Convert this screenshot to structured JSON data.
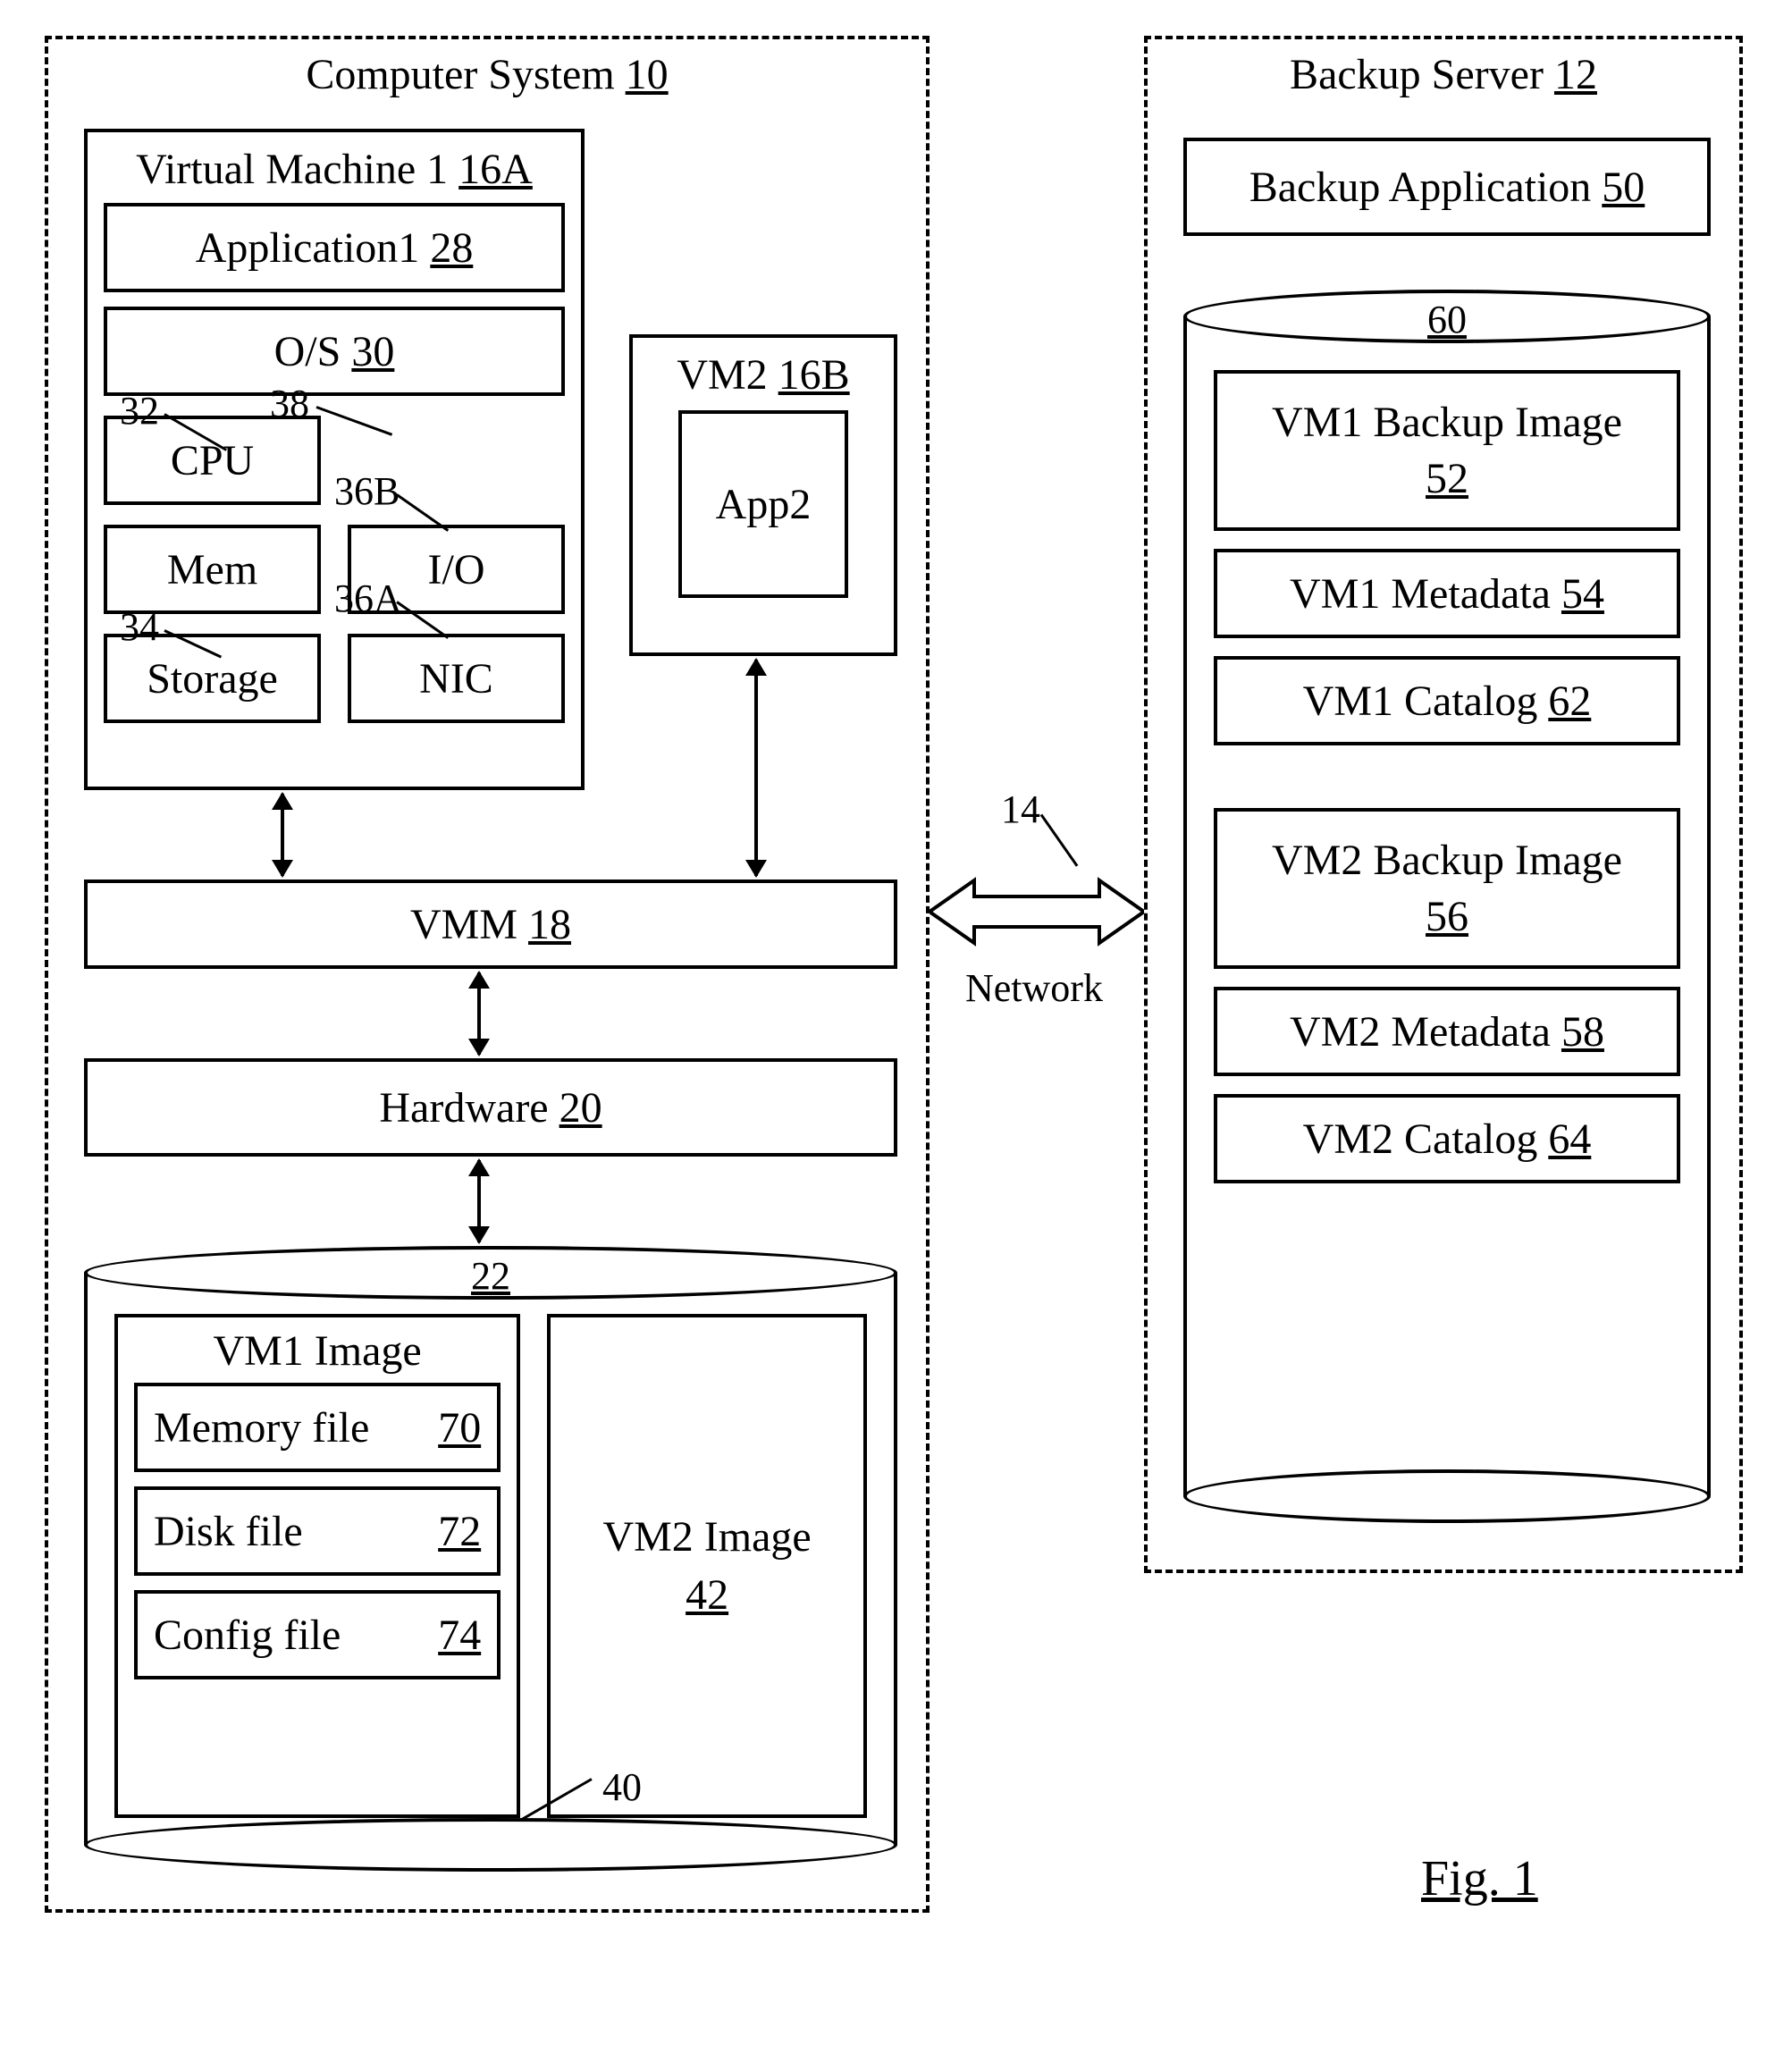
{
  "computer_system": {
    "title_text": "Computer System",
    "title_num": "10",
    "vm1": {
      "title_text": "Virtual Machine 1",
      "title_num": "16A",
      "app_text": "Application1",
      "app_num": "28",
      "os_text": "O/S",
      "os_num": "30",
      "cpu": "CPU",
      "mem": "Mem",
      "storage": "Storage",
      "io": "I/O",
      "nic": "NIC"
    },
    "vm2": {
      "title_text": "VM2",
      "title_num": "16B",
      "app": "App2"
    },
    "vmm_text": "VMM",
    "vmm_num": "18",
    "hw_text": "Hardware",
    "hw_num": "20",
    "storage_cyl": {
      "num": "22",
      "vm1img": {
        "title": "VM1 Image",
        "mem_text": "Memory file",
        "mem_num": "70",
        "disk_text": "Disk file",
        "disk_num": "72",
        "cfg_text": "Config file",
        "cfg_num": "74"
      },
      "vm2img_text": "VM2 Image",
      "vm2img_num": "42"
    }
  },
  "leads": {
    "l32": "32",
    "l34": "34",
    "l38": "38",
    "l36B": "36B",
    "l36A": "36A",
    "l40": "40",
    "l14": "14",
    "network": "Network"
  },
  "backup_server": {
    "title_text": "Backup Server",
    "title_num": "12",
    "app_text": "Backup Application",
    "app_num": "50",
    "cyl_num": "60",
    "items": {
      "bi1_text": "VM1 Backup Image",
      "bi1_num": "52",
      "md1_text": "VM1 Metadata",
      "md1_num": "54",
      "cat1_text": "VM1 Catalog",
      "cat1_num": "62",
      "bi2_text": "VM2 Backup Image",
      "bi2_num": "56",
      "md2_text": "VM2 Metadata",
      "md2_num": "58",
      "cat2_text": "VM2 Catalog",
      "cat2_num": "64"
    }
  },
  "figure": "Fig. 1"
}
